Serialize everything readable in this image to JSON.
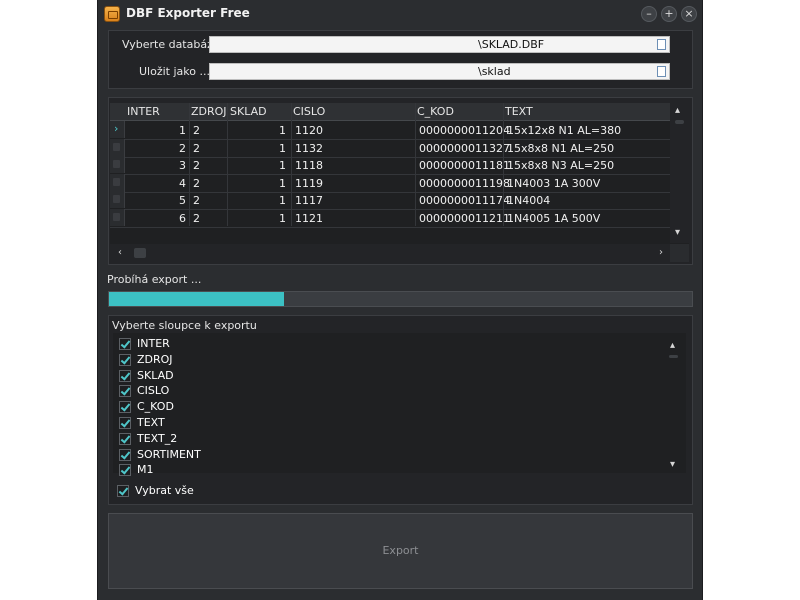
{
  "window": {
    "title": "DBF Exporter Free",
    "buttons": [
      "–",
      "+",
      "×"
    ]
  },
  "source": {
    "db_label": "Vyberte databázi",
    "db_value": "\\SKLAD.DBF",
    "save_label": "Uložit jako ...",
    "save_value": "\\sklad"
  },
  "table": {
    "headers": [
      "INTER",
      "ZDROJ",
      "SKLAD",
      "CISLO",
      "C_KOD",
      "TEXT"
    ],
    "rows": [
      [
        "1",
        "2",
        "1",
        "1120",
        "0000000011204",
        "15x12x8 N1 AL=380"
      ],
      [
        "2",
        "2",
        "1",
        "1132",
        "0000000011327",
        "15x8x8 N1 AL=250"
      ],
      [
        "3",
        "2",
        "1",
        "1118",
        "0000000011181",
        "15x8x8 N3 AL=250"
      ],
      [
        "4",
        "2",
        "1",
        "1119",
        "0000000011198",
        "1N4003 1A 300V"
      ],
      [
        "5",
        "2",
        "1",
        "1117",
        "0000000011174",
        "1N4004"
      ],
      [
        "6",
        "2",
        "1",
        "1121",
        "0000000011211",
        "1N4005 1A 500V"
      ]
    ]
  },
  "progress": {
    "label": "Probíhá export ...",
    "fraction": 0.3
  },
  "columns": {
    "title": "Vyberte sloupce k exportu",
    "items": [
      "INTER",
      "ZDROJ",
      "SKLAD",
      "CISLO",
      "C_KOD",
      "TEXT",
      "TEXT_2",
      "SORTIMENT",
      "M1"
    ],
    "select_all": "Vybrat vše"
  },
  "export_label": "Export",
  "colors": {
    "accent": "#3cc1c4",
    "background": "#2b2d30"
  },
  "icons": [
    "app-icon",
    "file-icon",
    "check-icon",
    "chevron-up-icon",
    "chevron-down-icon",
    "chevron-left-icon",
    "chevron-right-icon"
  ]
}
